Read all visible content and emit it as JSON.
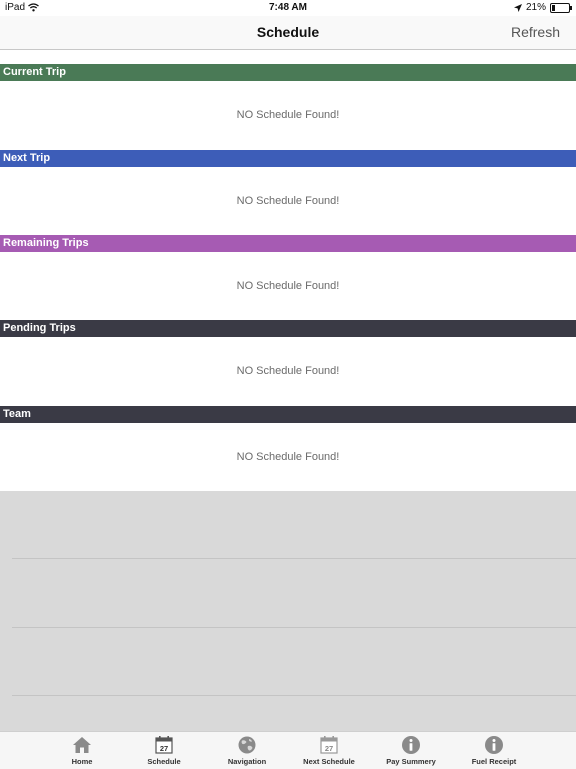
{
  "status_bar": {
    "device": "iPad",
    "time": "7:48 AM",
    "battery": "21%",
    "battery_level": 0.21
  },
  "nav": {
    "title": "Schedule",
    "refresh": "Refresh"
  },
  "sections": [
    {
      "title": "Current Trip",
      "message": "NO Schedule Found!",
      "color": "#4a7a56"
    },
    {
      "title": "Next Trip",
      "message": "NO Schedule Found!",
      "color": "#3d5db8"
    },
    {
      "title": "Remaining Trips",
      "message": "NO Schedule Found!",
      "color": "#a65bb3"
    },
    {
      "title": "Pending Trips",
      "message": "NO Schedule Found!",
      "color": "#3a3a45"
    },
    {
      "title": "Team",
      "message": "NO Schedule Found!",
      "color": "#3a3a45"
    }
  ],
  "tabs": [
    {
      "label": "Home",
      "icon": "home-icon"
    },
    {
      "label": "Schedule",
      "icon": "calendar-icon",
      "day": "27"
    },
    {
      "label": "Navigation",
      "icon": "globe-icon"
    },
    {
      "label": "Next Schedule",
      "icon": "calendar-icon",
      "day": "27"
    },
    {
      "label": "Pay Summery",
      "icon": "info-icon"
    },
    {
      "label": "Fuel Receipt",
      "icon": "info-icon"
    }
  ]
}
